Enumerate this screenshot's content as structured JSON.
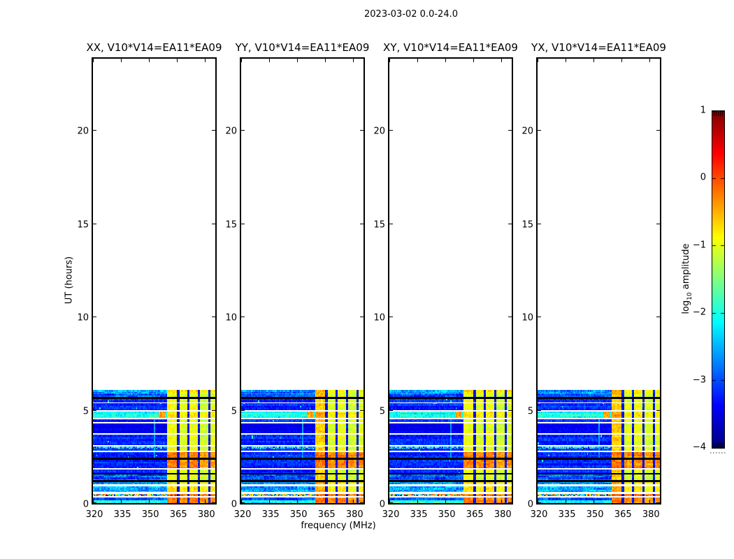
{
  "figure": {
    "title": "2023-03-02 0.0-24.0"
  },
  "panels": [
    {
      "title": "XX, V10*V14=EA11*EA09"
    },
    {
      "title": "YY, V10*V14=EA11*EA09"
    },
    {
      "title": "XY, V10*V14=EA11*EA09"
    },
    {
      "title": "YX, V10*V14=EA11*EA09"
    }
  ],
  "axes": {
    "xlabel": "frequency (MHz)",
    "ylabel": "UT (hours)",
    "xtick_labels": [
      "320",
      "335",
      "350",
      "365",
      "380"
    ],
    "xtick_values": [
      320,
      335,
      350,
      365,
      380
    ],
    "ytick_labels": [
      "0",
      "5",
      "10",
      "15",
      "20"
    ],
    "ytick_values": [
      0,
      5,
      10,
      15,
      20
    ],
    "xlim": [
      320,
      385.5
    ],
    "ylim": [
      0,
      24
    ]
  },
  "colorbar": {
    "label_prefix": "log",
    "label_sub": "10",
    "label_suffix": " amplitude",
    "label_plain": "log10 amplitude",
    "tick_labels": [
      "1",
      "0",
      "−1",
      "−2",
      "−3",
      "−4"
    ],
    "tick_values": [
      1,
      0,
      -1,
      -2,
      -3,
      -4
    ],
    "clim": [
      -4,
      1
    ],
    "colormap": "jet"
  },
  "chart_data": {
    "type": "heatmap",
    "title": "2023-03-02 0.0-24.0",
    "panels": [
      "XX, V10*V14=EA11*EA09",
      "YY, V10*V14=EA11*EA09",
      "XY, V10*V14=EA11*EA09",
      "YX, V10*V14=EA11*EA09"
    ],
    "xlabel": "frequency (MHz)",
    "ylabel": "UT (hours)",
    "xlim_mhz": [
      320,
      385.5
    ],
    "ylim_hours": [
      0,
      24
    ],
    "colormap": "jet",
    "clim_log10_amplitude": [
      -4,
      1
    ],
    "data_time_extent_hours": [
      0,
      6.08
    ],
    "background_log10_amp": -3.2,
    "rfi_band": {
      "freq_mhz": [
        359.5,
        385.5
      ],
      "level": -1.05,
      "hot_level": -0.35,
      "warm_level": -0.85,
      "gap_freqs_mhz": [
        365.5,
        371.0,
        376.5,
        382.0
      ],
      "gap_halfwidth_mhz": 0.6,
      "column_level_offsets": [
        0.12,
        0.0,
        0.08,
        -0.05,
        0.03
      ]
    },
    "transient_blob": {
      "freq_mhz": [
        355.0,
        358.5
      ],
      "time_hours": [
        4.6,
        4.92
      ],
      "level": -0.45
    },
    "faint_vline": {
      "freq_mhz": 352.7,
      "time_hours": [
        2.4,
        4.55
      ],
      "level": -2.6
    },
    "level_by_row_type": {
      "blue": -3.2,
      "blue2": -2.95,
      "bluedark": -3.45,
      "cyan": -2.05,
      "cyan2": -2.6,
      "speckle": "uniform(-3.3, 0.4)",
      "speckle2": -2.4,
      "white": "no data",
      "black": "flagged"
    },
    "time_segments": [
      {
        "t0": 0.0,
        "t1": 0.18,
        "type": "cyan",
        "band": "hot"
      },
      {
        "t0": 0.18,
        "t1": 0.32,
        "type": "blue2",
        "band": "hot"
      },
      {
        "t0": 0.32,
        "t1": 0.4,
        "type": "white"
      },
      {
        "t0": 0.4,
        "t1": 0.52,
        "type": "speckle",
        "band": "hot"
      },
      {
        "t0": 0.52,
        "t1": 0.62,
        "type": "white"
      },
      {
        "t0": 0.62,
        "t1": 0.92,
        "type": "cyan2"
      },
      {
        "t0": 0.92,
        "t1": 1.04,
        "type": "white"
      },
      {
        "t0": 1.04,
        "t1": 1.14,
        "type": "cyan2"
      },
      {
        "t0": 1.14,
        "t1": 1.24,
        "type": "black"
      },
      {
        "t0": 1.24,
        "t1": 1.54,
        "type": "blue2"
      },
      {
        "t0": 1.54,
        "t1": 1.64,
        "type": "black"
      },
      {
        "t0": 1.64,
        "t1": 1.8,
        "type": "blue"
      },
      {
        "t0": 1.8,
        "t1": 1.88,
        "type": "white"
      },
      {
        "t0": 1.88,
        "t1": 2.34,
        "type": "blue",
        "band": "hot"
      },
      {
        "t0": 2.34,
        "t1": 2.46,
        "type": "black"
      },
      {
        "t0": 2.46,
        "t1": 2.74,
        "type": "blue",
        "band": "hot"
      },
      {
        "t0": 2.74,
        "t1": 2.82,
        "type": "white"
      },
      {
        "t0": 2.82,
        "t1": 2.96,
        "type": "blue"
      },
      {
        "t0": 2.96,
        "t1": 3.04,
        "type": "speckle2"
      },
      {
        "t0": 3.04,
        "t1": 3.12,
        "type": "white"
      },
      {
        "t0": 3.12,
        "t1": 3.68,
        "type": "blue"
      },
      {
        "t0": 3.68,
        "t1": 3.78,
        "type": "white"
      },
      {
        "t0": 3.78,
        "t1": 4.28,
        "type": "bluedark"
      },
      {
        "t0": 4.28,
        "t1": 4.36,
        "type": "white"
      },
      {
        "t0": 4.36,
        "t1": 4.52,
        "type": "blue"
      },
      {
        "t0": 4.52,
        "t1": 4.6,
        "type": "white"
      },
      {
        "t0": 4.6,
        "t1": 4.94,
        "type": "cyan"
      },
      {
        "t0": 4.94,
        "t1": 5.02,
        "type": "white"
      },
      {
        "t0": 5.02,
        "t1": 5.36,
        "type": "blue"
      },
      {
        "t0": 5.36,
        "t1": 5.43,
        "type": "white"
      },
      {
        "t0": 5.43,
        "t1": 5.62,
        "type": "blue"
      },
      {
        "t0": 5.62,
        "t1": 5.72,
        "type": "black"
      },
      {
        "t0": 5.72,
        "t1": 5.88,
        "type": "blue2"
      },
      {
        "t0": 5.88,
        "t1": 6.08,
        "type": "cyan2"
      }
    ]
  }
}
